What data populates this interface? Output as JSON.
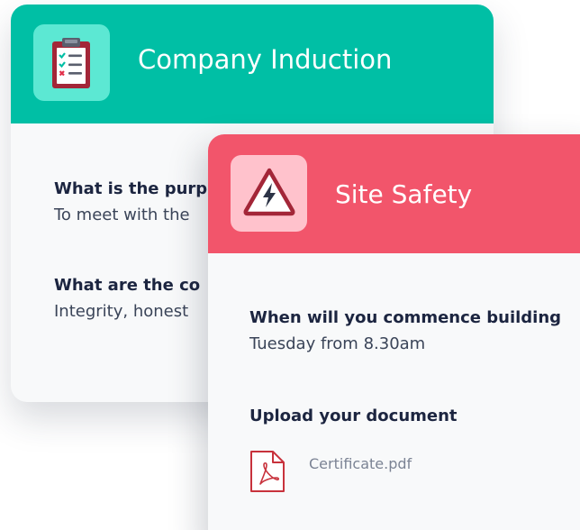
{
  "induction_card": {
    "title": "Company Induction",
    "icon": "clipboard-checklist-icon",
    "colors": {
      "header": "#00bfa5",
      "icon_tile": "#5ce8d3",
      "clipboard": "#a32638"
    },
    "items": [
      {
        "question": "What is the purp",
        "answer": "To meet with the"
      },
      {
        "question": "What are the co",
        "answer": "Integrity, honest"
      }
    ]
  },
  "safety_card": {
    "title": "Site Safety",
    "icon": "warning-lightning-icon",
    "colors": {
      "header": "#f2556b",
      "icon_tile": "#ffc2cc",
      "warning": "#a32638"
    },
    "items": [
      {
        "question": "When will you commence building",
        "answer": "Tuesday from 8.30am"
      }
    ],
    "upload": {
      "label": "Upload your document",
      "file_icon": "pdf-file-icon",
      "file_name": "Certificate.pdf"
    }
  }
}
